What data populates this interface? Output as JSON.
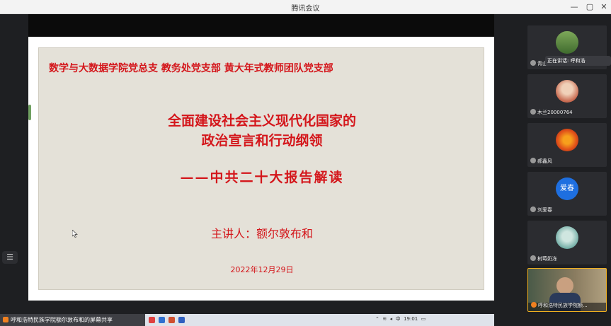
{
  "window": {
    "title": "腾讯会议",
    "minimize": "—",
    "restore": "▢",
    "close": "✕"
  },
  "slide": {
    "org": "数学与大数据学院党总支  教务处党支部   黄大年式教师团队党支部",
    "title_line1": "全面建设社会主义现代化国家的",
    "title_line2": "政治宣言和行动纲领",
    "subtitle": "——中共二十大报告解读",
    "speaker": "主讲人：额尔敦布和",
    "date": "2022年12月29日"
  },
  "participants": {
    "speaking_label": "正在讲话: 呼和浩",
    "list": [
      {
        "name": "青山"
      },
      {
        "name": "木兰20000764"
      },
      {
        "name": "郝鑫风"
      },
      {
        "name": "刘爱春",
        "avatar_text": "爱春"
      },
      {
        "name": "树莓奶冻"
      },
      {
        "name": "呼和浩特民族学院额..."
      }
    ]
  },
  "bottom_bar": {
    "sharer": "呼和浩特民族学院额尔敦布和的屏幕共享",
    "tray_time": "19:01",
    "tray_ime": "中"
  },
  "sidebar_toggle": "☰",
  "colors": {
    "slide_red": "#d4161b",
    "slide_bg": "#e4e1d8",
    "avatar_blue": "#1e6fe0"
  }
}
